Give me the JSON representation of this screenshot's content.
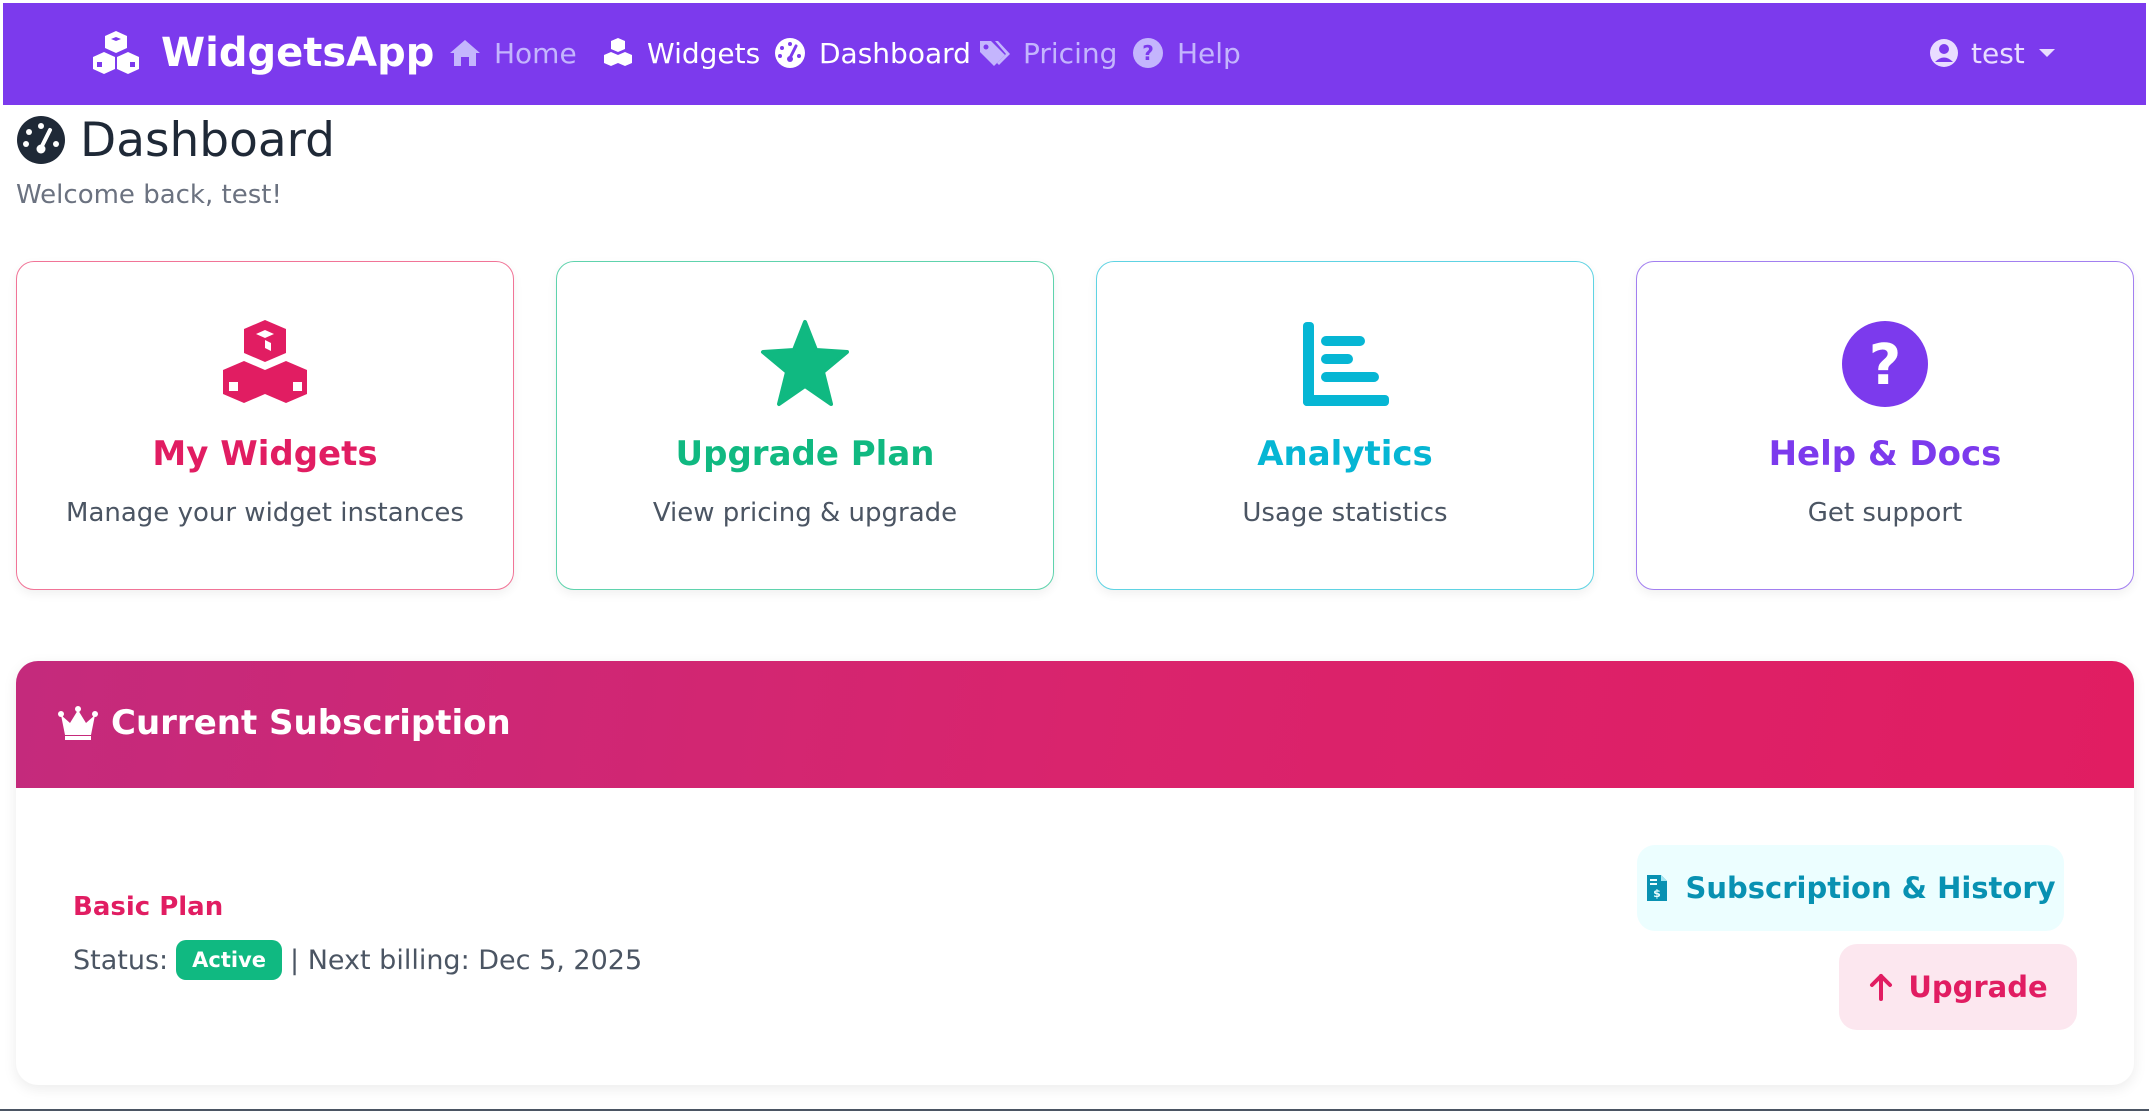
{
  "app": {
    "name": "WidgetsApp"
  },
  "nav": {
    "items": [
      {
        "label": "Home",
        "icon": "home-icon",
        "active": false
      },
      {
        "label": "Widgets",
        "icon": "cubes-icon",
        "active": true
      },
      {
        "label": "Dashboard",
        "icon": "gauge-icon",
        "active": true
      },
      {
        "label": "Pricing",
        "icon": "tags-icon",
        "active": false
      },
      {
        "label": "Help",
        "icon": "question-circle-icon",
        "active": false
      }
    ],
    "user": {
      "label": "test",
      "icon": "user-circle-icon"
    }
  },
  "page": {
    "title": "Dashboard",
    "title_icon": "gauge-icon",
    "welcome": "Welcome back, test!"
  },
  "cards": [
    {
      "title": "My Widgets",
      "subtitle": "Manage your widget instances",
      "icon": "cubes-icon",
      "color": "#e11d62"
    },
    {
      "title": "Upgrade Plan",
      "subtitle": "View pricing & upgrade",
      "icon": "star-icon",
      "color": "#10b981"
    },
    {
      "title": "Analytics",
      "subtitle": "Usage statistics",
      "icon": "bar-chart-icon",
      "color": "#06b6d4"
    },
    {
      "title": "Help & Docs",
      "subtitle": "Get support",
      "icon": "question-circle-icon",
      "color": "#7c3aed"
    }
  ],
  "subscription": {
    "header": "Current Subscription",
    "header_icon": "crown-icon",
    "plan_name": "Basic Plan",
    "status_label": "Status:",
    "status_badge": "Active",
    "billing_text": "| Next billing: Dec 5, 2025",
    "history_button": "Subscription & History",
    "history_icon": "invoice-dollar-icon",
    "upgrade_button": "Upgrade",
    "upgrade_icon": "arrow-up-icon"
  },
  "colors": {
    "navbar": "#7c3aed",
    "accent_pink": "#e11d62",
    "accent_green": "#10b981",
    "accent_cyan": "#06b6d4",
    "accent_purple": "#7c3aed"
  }
}
